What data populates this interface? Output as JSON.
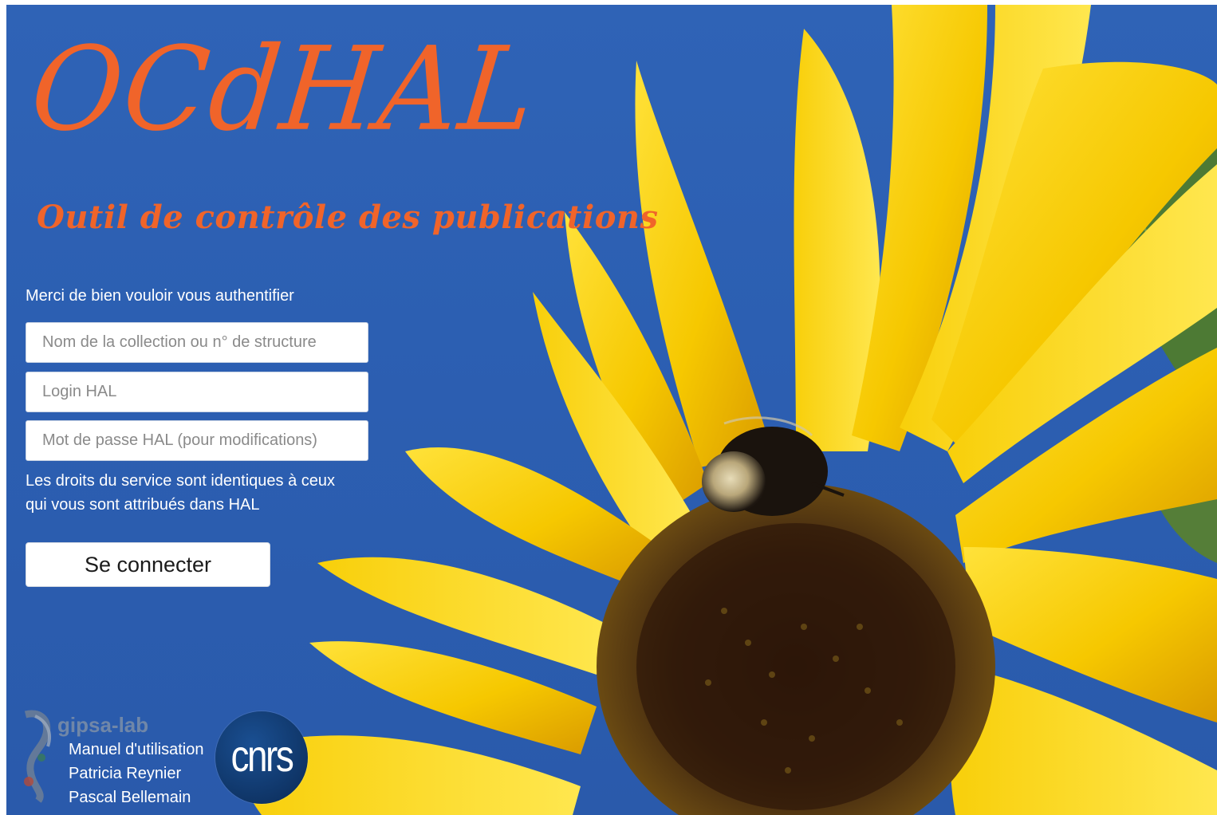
{
  "branding": {
    "title": "OCdHAL",
    "subtitle": "Outil de contrôle des publications",
    "gipsa_name": "gipsa-lab",
    "cnrs_name": "cnrs"
  },
  "login": {
    "prompt": "Merci de bien vouloir vous authentifier",
    "collection_placeholder": "Nom de la collection ou n° de structure",
    "login_placeholder": "Login HAL",
    "password_placeholder": "Mot de passe HAL (pour modifications)",
    "rights_line1": "Les droits du service sont identiques à ceux",
    "rights_line2": "qui vous sont attribués dans HAL",
    "submit_label": "Se connecter"
  },
  "footer": {
    "manual_link": "Manuel d'utilisation",
    "author1": "Patricia Reynier",
    "author2": "Pascal Bellemain"
  },
  "colors": {
    "sky_blue": "#2c5fb2",
    "title_orange": "#f0642a",
    "petal_yellow": "#f6c800",
    "flower_center": "#3a1e0c",
    "cnrs_blue": "#0f3567"
  },
  "icons": {
    "background": "sunflower-bee-photo",
    "left_logo": "gipsa-lab-logo",
    "right_logo": "cnrs-logo"
  }
}
